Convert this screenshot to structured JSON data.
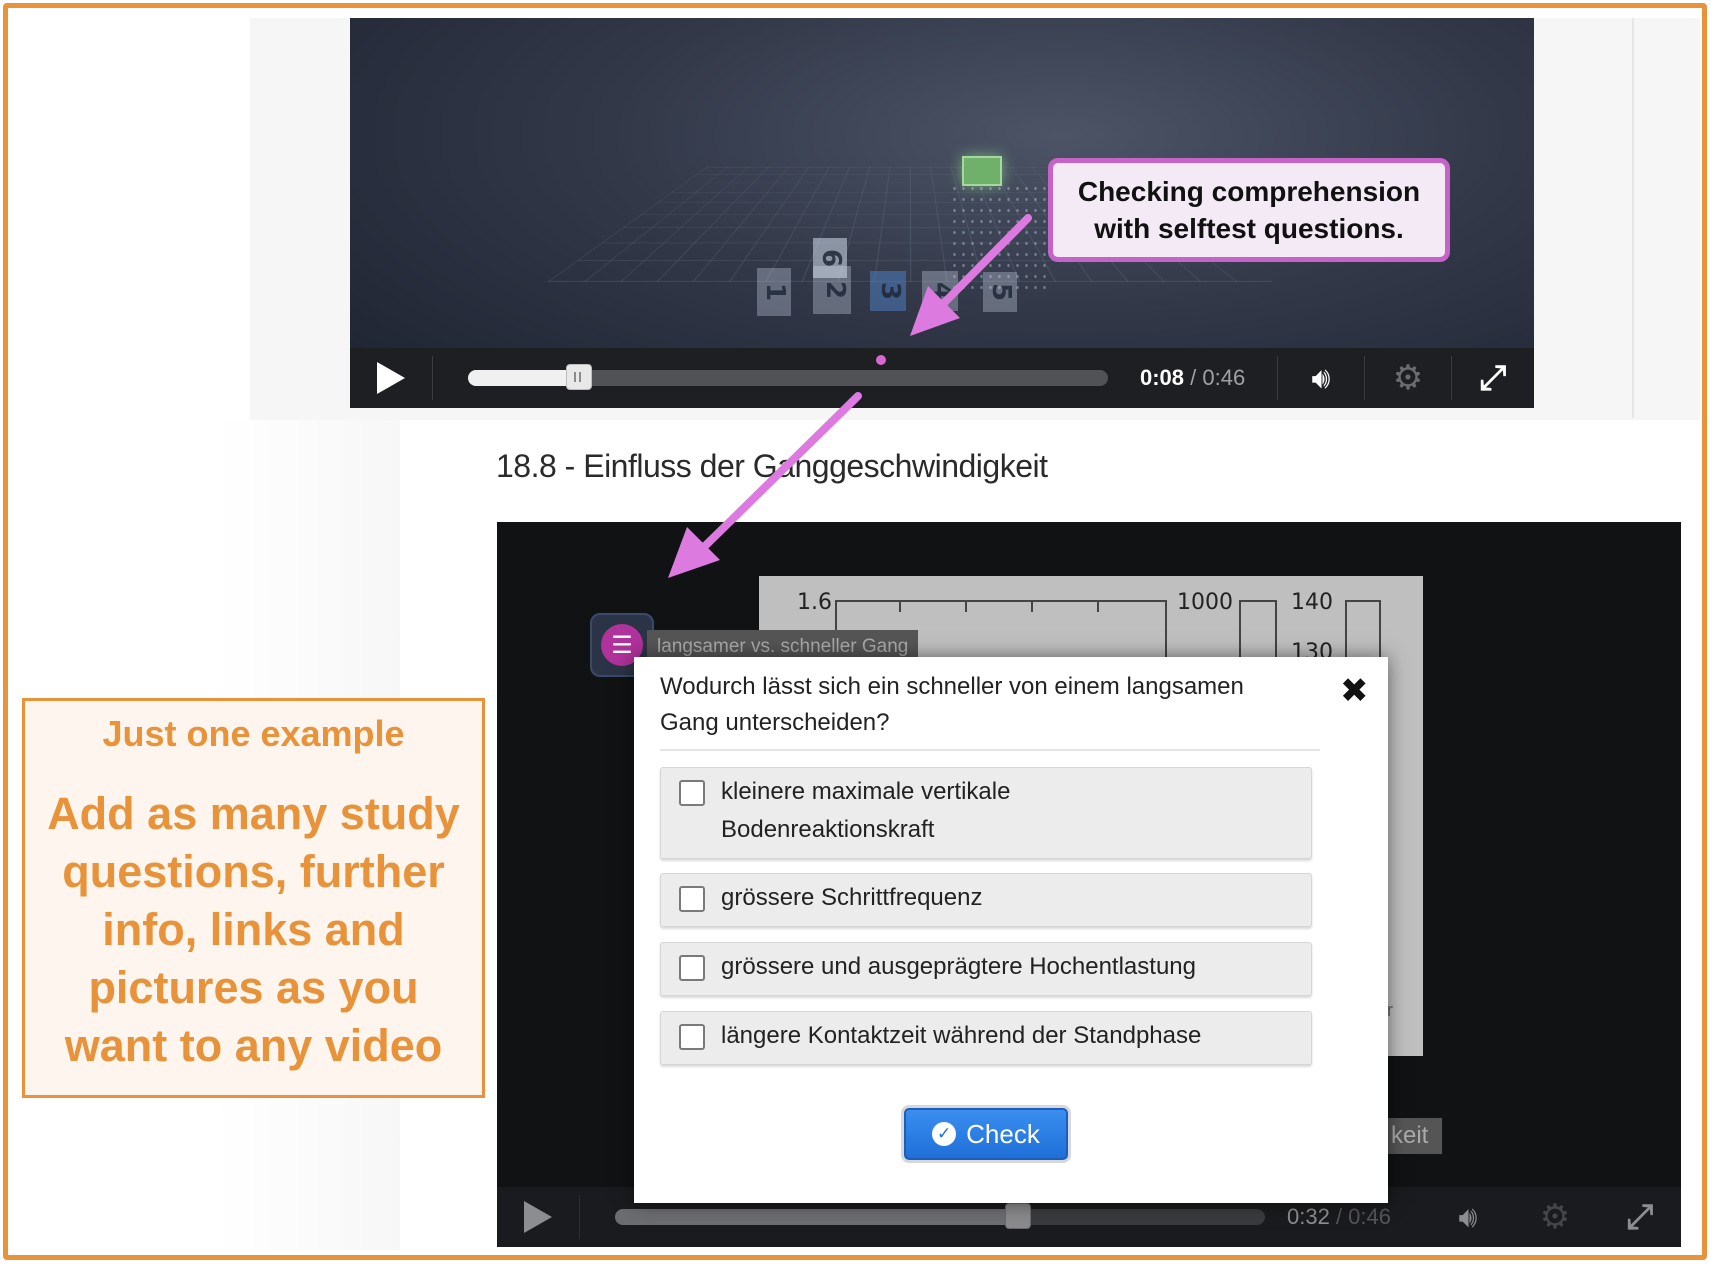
{
  "colors": {
    "frame": "#e8923a",
    "callout_border": "#c663c9",
    "arrow": "#dd7ae0",
    "check_button": "#1f6fd8"
  },
  "top_video": {
    "tile_numbers": [
      "1",
      "2",
      "6",
      "3",
      "4",
      "5"
    ],
    "progress_fraction": 0.174,
    "marker_fraction": 0.645,
    "time_current": "0:08",
    "time_separator": " / ",
    "time_duration": "0:46",
    "icons": {
      "play": "play-icon",
      "volume": "volume-icon",
      "settings": "gear-icon",
      "fullscreen": "expand-icon"
    }
  },
  "callout": {
    "line1": "Checking comprehension",
    "line2": "with selftest questions."
  },
  "section_title": "18.8 - Einfluss der Ganggeschwindigkeit",
  "second_video": {
    "chart_ticks": [
      "1.6",
      "1000",
      "140",
      "130"
    ],
    "chapter_label": "langsamer vs. schneller Gang",
    "chapter_end_label": "keit",
    "side_text": [
      "er",
      "e"
    ],
    "progress_fraction": 0.62,
    "time_current": "0:32",
    "time_separator": " / ",
    "time_duration": "0:46"
  },
  "quiz": {
    "question_line1": "Wodurch lässt sich ein schneller von einem langsamen",
    "question_line2": "Gang unterscheiden?",
    "options": [
      {
        "line1": "kleinere maximale vertikale",
        "line2": "Bodenreaktionskraft",
        "checked": false
      },
      {
        "line1": "grössere Schrittfrequenz",
        "checked": false
      },
      {
        "line1": "grössere und ausgeprägtere Hochentlastung",
        "checked": false
      },
      {
        "line1": "längere Kontaktzeit während der Standphase",
        "checked": false
      }
    ],
    "check_label": "Check",
    "close_icon": "close-icon"
  },
  "info_box": {
    "heading": "Just one example",
    "body_lines": [
      "Add as many study",
      "questions, further",
      "info, links and",
      "pictures as you",
      "want to any video"
    ]
  }
}
